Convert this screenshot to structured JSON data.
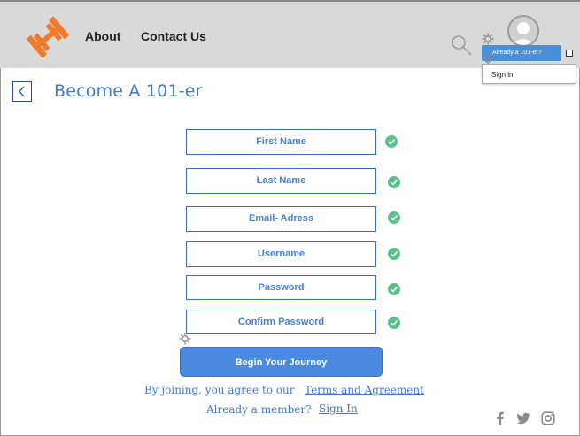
{
  "header": {
    "nav": {
      "about": "About",
      "contact": "Contact Us"
    },
    "account_popover": {
      "already_label": "Already a 101-er?",
      "signin_label": "Sign in"
    }
  },
  "page": {
    "title": "Become A 101-er"
  },
  "form": {
    "fields": [
      {
        "placeholder": "First Name",
        "valid": true
      },
      {
        "placeholder": "Last Name",
        "valid": true
      },
      {
        "placeholder": "Email- Adress",
        "valid": true
      },
      {
        "placeholder": "Username",
        "valid": true
      },
      {
        "placeholder": "Password",
        "valid": true
      },
      {
        "placeholder": "Confirm Password",
        "valid": true
      }
    ],
    "submit_label": "Begin Your Journey"
  },
  "footer_text": {
    "agree_prefix": "By joining, you agree to our",
    "terms_link": "Terms and Agreement",
    "member_prefix": "Already a member?",
    "signin_link": "Sign In"
  },
  "social": [
    "facebook-icon",
    "twitter-icon",
    "instagram-icon"
  ],
  "colors": {
    "header_bg": "#d9d9d9",
    "accent": "#4a8ae0",
    "title_blue": "#3f7ad1",
    "check_green": "#5cc08a",
    "logo_orange": "#f07b2a"
  }
}
